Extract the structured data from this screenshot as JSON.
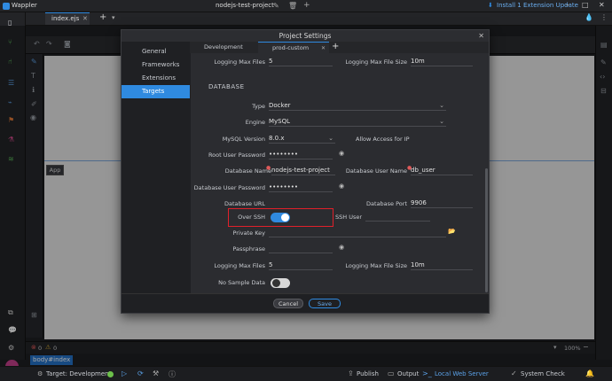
{
  "app": {
    "name": "Wappler",
    "project": "nodejs-test-project",
    "update_text": "Install 1 Extension Update",
    "file_tab": "index.ejs"
  },
  "canvas": {
    "app_label": "App",
    "breadcrumb": "body#index",
    "zoom": "100%",
    "errors": "0",
    "warnings": "0"
  },
  "statusbar": {
    "target": "Target: Development",
    "publish": "Publish",
    "output": "Output",
    "server": "Local Web Server",
    "system_check": "System Check"
  },
  "dialog": {
    "title": "Project Settings",
    "nav": [
      "General",
      "Frameworks",
      "Extensions",
      "Targets"
    ],
    "active_nav": "Targets",
    "tabs": [
      "Development",
      "prod-custom"
    ],
    "active_tab": "prod-custom",
    "fields": {
      "top_log_files_label": "Logging Max Files",
      "top_log_files_value": "5",
      "top_log_size_label": "Logging Max File Size",
      "top_log_size_value": "10m",
      "section": "DATABASE",
      "type_label": "Type",
      "type_value": "Docker",
      "engine_label": "Engine",
      "engine_value": "MySQL",
      "version_label": "MySQL Version",
      "version_value": "8.0.x",
      "remote_label": "Allow Access for IP",
      "root_pw_label": "Root User Password",
      "root_pw_value": "••••••••",
      "db_name_label": "Database Name",
      "db_name_value": "nodejs-test-project",
      "db_user_label": "Database User Name",
      "db_user_value": "db_user",
      "db_user_pw_label": "Database User Password",
      "db_user_pw_value": "••••••••",
      "db_url_label": "Database URL",
      "db_port_label": "Database Port",
      "db_port_value": "9906",
      "ssh_label": "Over SSH",
      "ssh_on": true,
      "ssh_user_label": "SSH User",
      "private_key_label": "Private Key",
      "passphrase_label": "Passphrase",
      "log_files_label": "Logging Max Files",
      "log_files_value": "5",
      "log_size_label": "Logging Max File Size",
      "log_size_value": "10m",
      "no_sample_label": "No Sample Data",
      "no_sample_on": false
    },
    "cancel": "Cancel",
    "save": "Save"
  },
  "colors": {
    "accent": "#2f8ae0",
    "highlight_box": "#e0202a",
    "bg": "#1e1f22"
  }
}
